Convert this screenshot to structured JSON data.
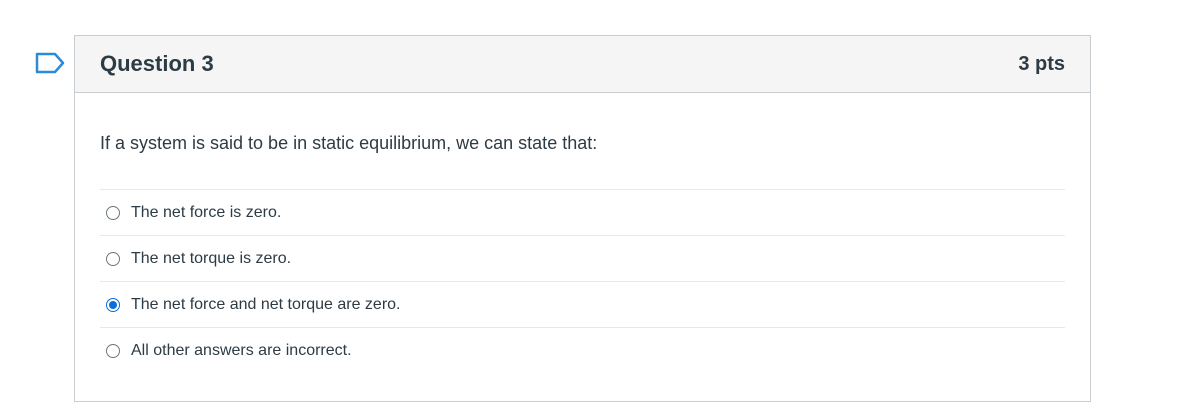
{
  "question": {
    "title": "Question 3",
    "points": "3 pts",
    "text": "If a system is said to be in static equilibrium, we can state that:",
    "answers": [
      {
        "label": "The net force is zero.",
        "selected": false
      },
      {
        "label": "The net torque is zero.",
        "selected": false
      },
      {
        "label": "The net force and net torque are zero.",
        "selected": true
      },
      {
        "label": "All other answers are incorrect.",
        "selected": false
      }
    ]
  },
  "icons": {
    "flag": "flag-question-icon"
  },
  "colors": {
    "accent": "#0a6fd8",
    "flag": "#2c8ad8",
    "text": "#2d3b45",
    "header_bg": "#f5f5f5",
    "border": "#c7cdd1"
  }
}
